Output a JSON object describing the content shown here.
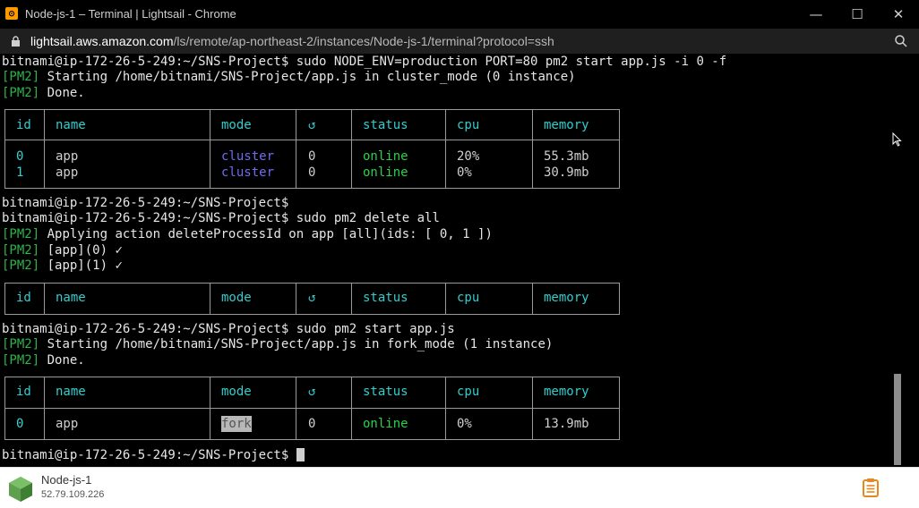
{
  "window": {
    "title": "Node-js-1 – Terminal | Lightsail - Chrome",
    "controls": {
      "minimize": "—",
      "maximize": "☐",
      "close": "✕"
    }
  },
  "addressbar": {
    "host": "lightsail.aws.amazon.com",
    "path": "/ls/remote/ap-northeast-2/instances/Node-js-1/terminal?protocol=ssh"
  },
  "terminal": {
    "prompt": "bitnami@ip-172-26-5-249:~/SNS-Project$",
    "pm2_tag": "[PM2]",
    "lines": {
      "cmd1": " sudo NODE_ENV=production PORT=80 pm2 start app.js -i 0 -f",
      "l2": " Starting /home/bitnami/SNS-Project/app.js in cluster_mode (0 instance)",
      "l3": " Done.",
      "cmd2": "",
      "cmd3": " sudo pm2 delete all",
      "l6": " Applying action deleteProcessId on app [all](ids: [ 0, 1 ])",
      "l7": " [app](0) ✓",
      "l8": " [app](1) ✓",
      "cmd4": " sudo pm2 start app.js",
      "l10": " Starting /home/bitnami/SNS-Project/app.js in fork_mode (1 instance)",
      "l11": " Done.",
      "cmd5": " "
    },
    "table_headers": [
      "id",
      "name",
      "mode",
      "↺",
      "status",
      "cpu",
      "memory"
    ],
    "table1_rows": [
      {
        "id": "0",
        "name": "app",
        "mode": "cluster",
        "restarts": "0",
        "status": "online",
        "cpu": "20%",
        "memory": "55.3mb"
      },
      {
        "id": "1",
        "name": "app",
        "mode": "cluster",
        "restarts": "0",
        "status": "online",
        "cpu": "0%",
        "memory": "30.9mb"
      }
    ],
    "table3_rows": [
      {
        "id": "0",
        "name": "app",
        "mode": "fork",
        "restarts": "0",
        "status": "online",
        "cpu": "0%",
        "memory": "13.9mb"
      }
    ]
  },
  "footer": {
    "instance_name": "Node-js-1",
    "instance_ip": "52.79.109.226"
  },
  "icons": {
    "app": "lightsail-icon",
    "lock": "lock-icon",
    "search": "search-icon",
    "node": "nodejs-icon",
    "clipboard": "clipboard-icon"
  },
  "colors": {
    "pm2_tag": "#2db34a",
    "table_header": "#33cccc",
    "cluster_mode": "#6f6cf0",
    "online": "#2ad14a",
    "clipboard": "#e8871e",
    "nodejs": "#5fa04e"
  }
}
